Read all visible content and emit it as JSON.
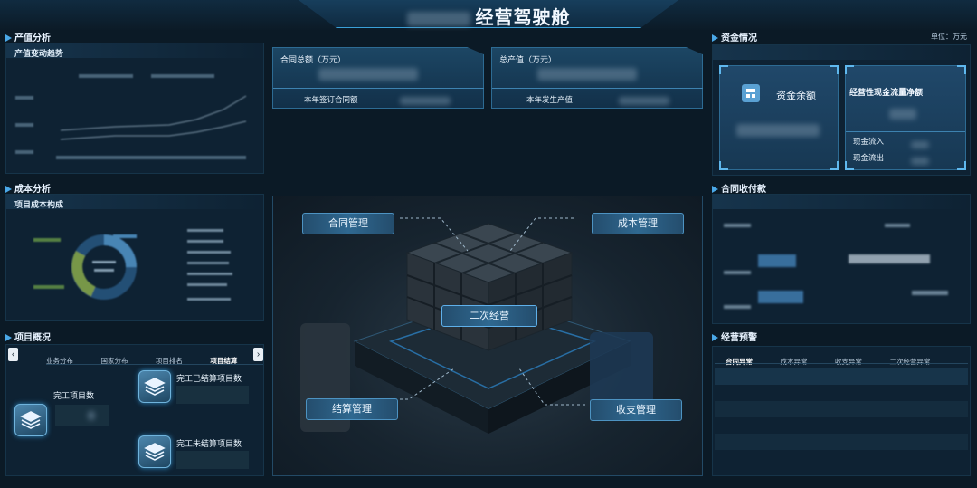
{
  "header": {
    "title": "经营驾驶舱"
  },
  "sections": {
    "output": "产值分析",
    "cost": "成本分析",
    "projects": "项目概况",
    "funds": "资金情况",
    "contract_payment": "合同收付款",
    "warning": "经营预警"
  },
  "output_panel": {
    "title": "产值变动趋势"
  },
  "cost_panel": {
    "title": "项目成本构成"
  },
  "contract_card": {
    "title": "合同总额（万元）",
    "sub_label": "本年签订合同额"
  },
  "value_card": {
    "title": "总产值（万元）",
    "sub_label": "本年发生产值"
  },
  "funds_panel": {
    "unit": "单位：万元",
    "balance_label": "资金余额",
    "cashflow_label": "经营性现金流量净额",
    "inflow_label": "现金流入",
    "outflow_label": "现金流出"
  },
  "project_panel": {
    "tabs": [
      "业务分布",
      "国家分布",
      "项目排名",
      "项目结算"
    ],
    "active_tab": "项目结算",
    "completed_label": "完工项目数",
    "settled_label": "完工已结算项目数",
    "unsettled_label": "完工未结算项目数"
  },
  "center": {
    "core_label": "二次经营",
    "contract_mgmt": "合同管理",
    "cost_mgmt": "成本管理",
    "settlement_mgmt": "结算管理",
    "revenue_mgmt": "收支管理"
  },
  "warning_panel": {
    "tabs": [
      "合同异常",
      "成本异常",
      "收支异常",
      "二次经营异常"
    ],
    "active_tab": "合同异常"
  },
  "colors": {
    "accent": "#4aa8e8",
    "background": "#0b1a26",
    "panel": "#0e2233"
  }
}
